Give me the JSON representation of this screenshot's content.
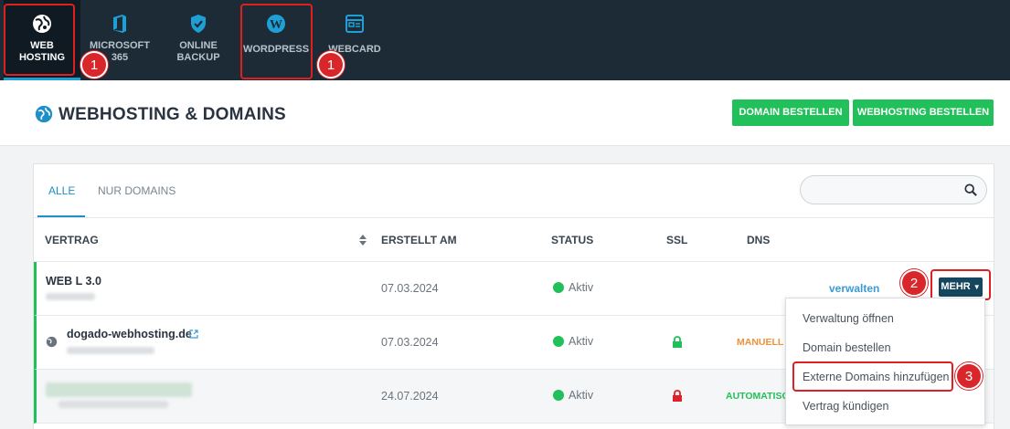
{
  "nav": {
    "items": [
      {
        "label_line1": "WEB",
        "label_line2": "HOSTING",
        "icon": "globe-icon",
        "active": true
      },
      {
        "label_line1": "MICROSOFT 365",
        "label_line2": "",
        "icon": "office-icon",
        "active": false
      },
      {
        "label_line1": "ONLINE",
        "label_line2": "BACKUP",
        "icon": "shield-icon",
        "active": false
      },
      {
        "label_line1": "WORDPRESS",
        "label_line2": "",
        "icon": "wordpress-icon",
        "active": false
      },
      {
        "label_line1": "WEBCARD",
        "label_line2": "",
        "icon": "webcard-icon",
        "active": false
      }
    ]
  },
  "annotations": {
    "badge_1a": "1",
    "badge_1b": "1",
    "badge_2": "2",
    "badge_3": "3",
    "highlight_color": "#e02020"
  },
  "header": {
    "title": "WEBHOSTING & DOMAINS",
    "btn_domain": "DOMAIN BESTELLEN",
    "btn_webhosting": "WEBHOSTING BESTELLEN"
  },
  "tabs": {
    "all": "ALLE",
    "domains_only": "NUR DOMAINS"
  },
  "search": {
    "placeholder": ""
  },
  "table": {
    "columns": {
      "vertrag": "VERTRAG",
      "erstellt": "ERSTELLT AM",
      "status": "STATUS",
      "ssl": "SSL",
      "dns": "DNS"
    },
    "rows": [
      {
        "name": "WEB L 3.0",
        "date": "07.03.2024",
        "status": "Aktiv",
        "action": "verwalten",
        "more": "MEHR"
      },
      {
        "name": "dogado-webhosting.de",
        "date": "07.03.2024",
        "status": "Aktiv",
        "ssl": "lock-green",
        "dns": "MANUELL"
      },
      {
        "name": "",
        "date": "24.07.2024",
        "status": "Aktiv",
        "ssl": "lock-red",
        "dns": "AUTOMATISC"
      }
    ]
  },
  "dropdown": {
    "items": [
      "Verwaltung öffnen",
      "Domain bestellen",
      "Externe Domains hinzufügen",
      "Vertrag kündigen"
    ]
  },
  "colors": {
    "nav_bg": "#1c2b36",
    "accent_blue": "#1e90c8",
    "green": "#22c05a",
    "mehr_bg": "#16465e",
    "lock_red": "#e0202a"
  }
}
